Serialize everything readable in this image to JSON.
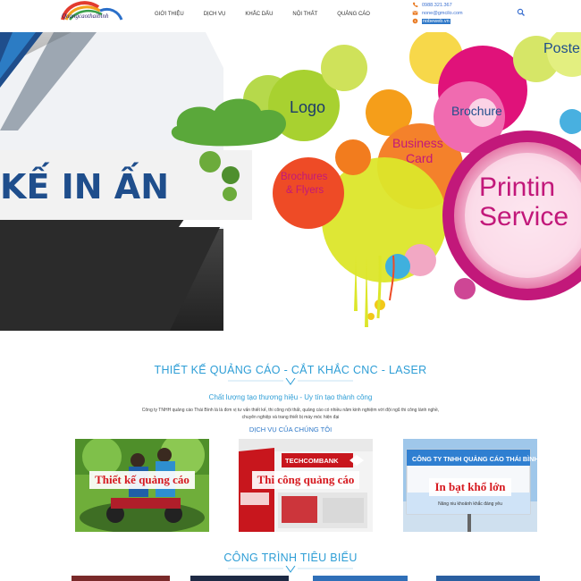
{
  "header": {
    "logo_text": "Quangcaothaibinh",
    "nav": [
      {
        "label": "GIỚI THIỆU"
      },
      {
        "label": "DỊCH VỤ"
      },
      {
        "label": "KHẮC DẤU"
      },
      {
        "label": "NỘI THẤT"
      },
      {
        "label": "QUẢNG CÁO"
      }
    ],
    "contacts": [
      {
        "icon": "phone-icon",
        "text": "0988.321.367"
      },
      {
        "icon": "email-icon",
        "text": "none@gmcilo.com"
      },
      {
        "icon": "skype-icon",
        "text": "nobeweb.vn"
      }
    ]
  },
  "banner": {
    "headline": "KẾ  IN ẤN",
    "circle_labels": {
      "logo": "Logo",
      "brochure": "Brochure",
      "business_line1": "Business",
      "business_line2": "Card",
      "brochures_line1": "Brochures",
      "brochures_line2": "& Flyers",
      "printing": "Printin",
      "service": "Service",
      "poster": "Poste"
    }
  },
  "intro": {
    "title": "THIẾT KẾ QUẢNG CÁO - CẮT KHẮC CNC - LASER",
    "slogan": "Chất lượng tạo thương hiệu - Uy tín tạo thành công",
    "description": "Công ty TNHH quảng cáo Thái Bình là là đơn vị tư vấn thiết kế, thi công nội thất, quảng cáo có nhiều năm kinh nghiệm với đội ngũ thi công lành nghề, chuyên nghiệp và trang thiết bị máy móc hiện đại",
    "services_title": "DỊCH VỤ CỦA CHÚNG TÔI"
  },
  "services": [
    {
      "label": "Thiết kế quảng cáo",
      "caption": ""
    },
    {
      "label": "Thi công quảng cáo",
      "caption": "",
      "sign_text": "TECHCOMBANK"
    },
    {
      "label": "In bạt khổ lớn",
      "caption": "Nâng niu khoảnh khắc đáng yêu",
      "sign_text": "CÔNG TY TNHH QUẢNG CÁO THÁI BÌNH"
    }
  ],
  "projects": {
    "title": "CÔNG TRÌNH TIÊU BIỂU"
  },
  "colors": {
    "accent": "#2e9ed6",
    "label_red": "#d6191f",
    "banner_blue": "#1f4e8c",
    "magenta": "#c2187a"
  }
}
